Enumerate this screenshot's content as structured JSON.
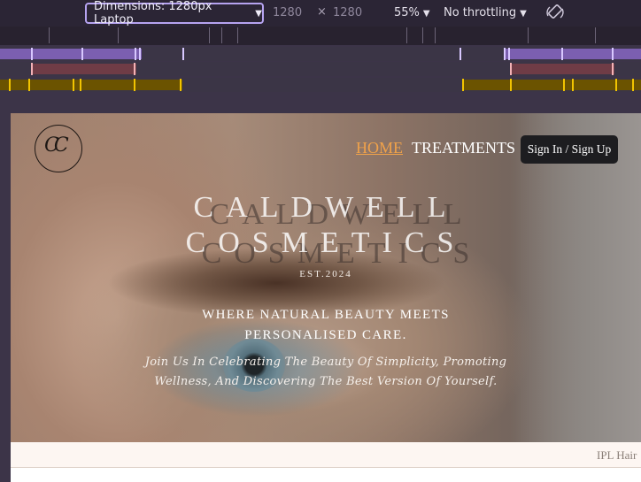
{
  "devtools": {
    "dimensions_label": "Dimensions: 1280px Laptop",
    "width_value": "1280",
    "times_symbol": "×",
    "height_value": "1280",
    "zoom_label": "55%",
    "throttle_label": "No throttling",
    "caret": "▼"
  },
  "site": {
    "nav": {
      "home": "HOME",
      "treatments": "TREATMENTS",
      "signin": "Sign In / Sign Up"
    },
    "brand_line1": "CALDWELL",
    "brand_line2": "COSMETICS",
    "est": "EST.2024",
    "tagline_line1": "WHERE NATURAL BEAUTY MEETS",
    "tagline_line2": "PERSONALISED CARE.",
    "sub_line1": "Join Us In Celebrating The Beauty Of Simplicity, Promoting",
    "sub_line2": "Wellness, And Discovering The Best Version Of Yourself.",
    "ticker": "IPL Hair",
    "accent_color": "#f0a24a"
  }
}
